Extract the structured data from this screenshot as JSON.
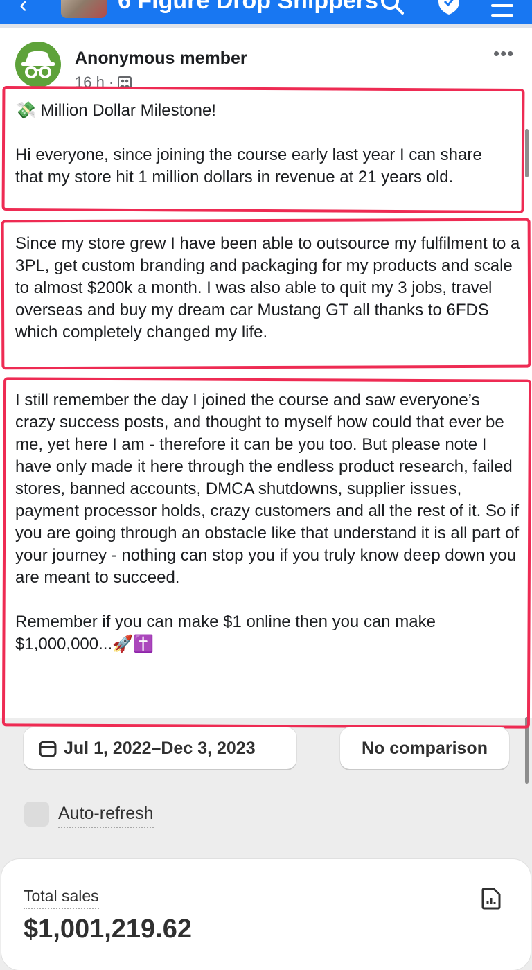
{
  "header": {
    "group_title": "6 Figure Drop Shippers"
  },
  "post": {
    "author": "Anonymous member",
    "time": "16 h ·",
    "more_label": "•••",
    "paragraph_1": "💸 Million Dollar Milestone!\n\nHi everyone, since joining the course early last year I can share that my store hit 1 million dollars in revenue at 21 years old.",
    "paragraph_2": "Since my store grew I have been able to outsource my fulfilment to a 3PL, get custom branding and packaging for my products and scale to almost $200k a month. I was also able to quit my 3 jobs, travel overseas and buy my dream car Mustang GT all thanks to 6FDS which completely changed my life.",
    "paragraph_3": "I still remember the day I joined the course and saw everyone’s crazy success posts, and thought to myself how could that ever be me, yet here I am - therefore it can be you too. But please note I have only made it here through the endless product research, failed stores, banned accounts, DMCA shutdowns, supplier issues, payment processor holds, crazy customers and all the rest of it. So if you are going through an obstacle like that understand it is all part of your journey - nothing can stop you if you truly know deep down you are meant to succeed.\n\nRemember if you can make $1 online then you can make $1,000,000...🚀✝️"
  },
  "analytics": {
    "date_range": "Jul 1, 2022–Dec 3, 2023",
    "comparison": "No comparison",
    "auto_refresh_label": "Auto-refresh",
    "total_sales_label": "Total sales",
    "total_sales_value": "$1,001,219.62"
  },
  "colors": {
    "facebook_blue": "#1877f2",
    "highlight_red": "#ee2b53",
    "avatar_green": "#5ea23a"
  },
  "icons": [
    "back-arrow-icon",
    "search-icon",
    "shield-icon",
    "menu-icon",
    "incognito-icon",
    "group-privacy-icon",
    "calendar-icon",
    "report-icon"
  ]
}
